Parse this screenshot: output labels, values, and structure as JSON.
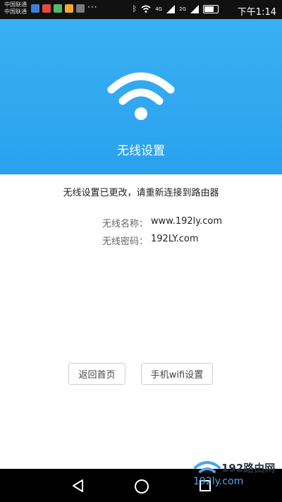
{
  "status_bar": {
    "carrier_1": "中国联通",
    "carrier_2": "中国联通",
    "dots": "···",
    "signal_4g": "4G",
    "signal_2g": "2G",
    "time": "下午1:14",
    "battery_level": 0.8
  },
  "header": {
    "icon": "wifi-icon",
    "title": "无线设置",
    "color": "#39b0f2"
  },
  "message": "无线设置已更改，请重新连接到路由器",
  "wifi_info": {
    "name_label": "无线名称：",
    "name_value": "www.192ly.com",
    "password_label": "无线密码：",
    "password_value": "192LY.com"
  },
  "buttons": {
    "home": "返回首页",
    "phone_wifi": "手机wifi设置"
  },
  "nav_bar": {
    "back_icon": "back-icon",
    "home_icon": "home-icon",
    "recent_icon": "recent-apps-icon"
  },
  "watermark": {
    "brand": "192路由网",
    "url": "192ly.com"
  }
}
